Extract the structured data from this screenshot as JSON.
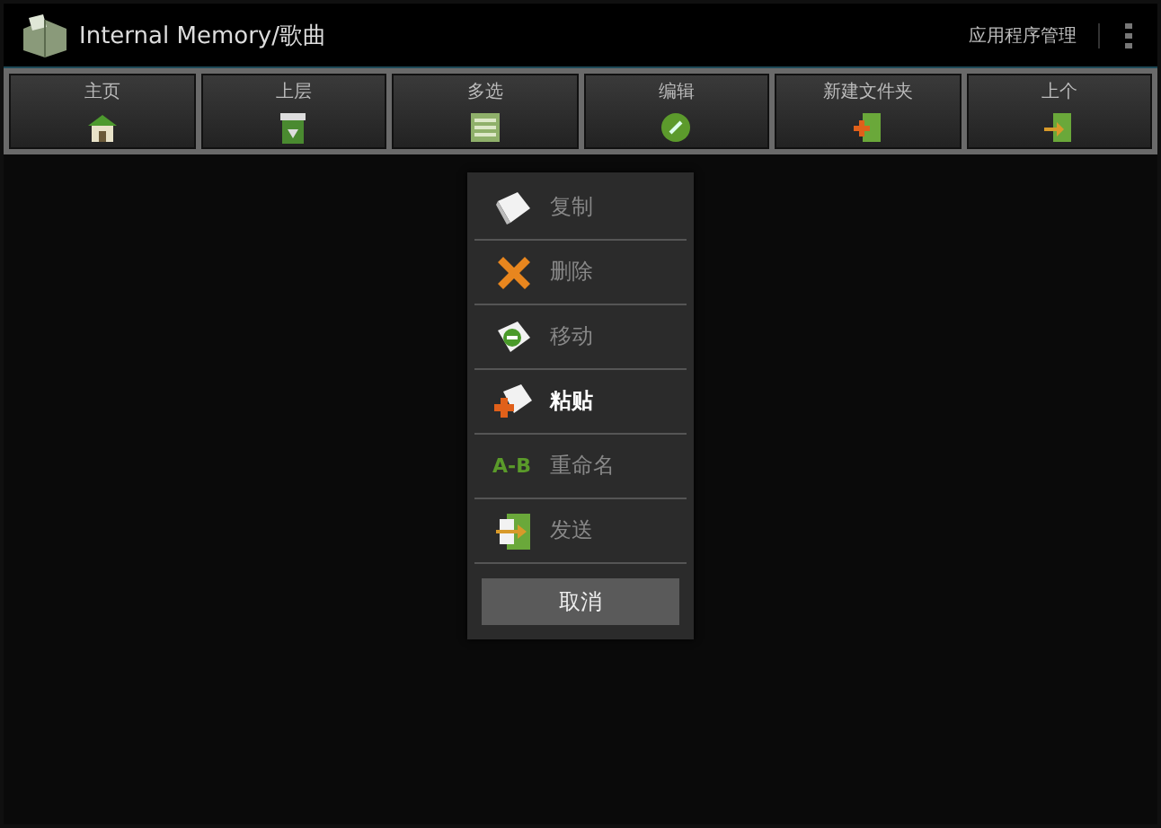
{
  "title_bar": {
    "title": "Internal Memory/歌曲",
    "action": "应用程序管理"
  },
  "toolbar": [
    {
      "label": "主页",
      "kind": "home"
    },
    {
      "label": "上层",
      "kind": "up"
    },
    {
      "label": "多选",
      "kind": "multi"
    },
    {
      "label": "编辑",
      "kind": "edit"
    },
    {
      "label": "新建文件夹",
      "kind": "newfolder"
    },
    {
      "label": "上个",
      "kind": "back"
    }
  ],
  "menu": {
    "items": [
      {
        "label": "复制",
        "kind": "copy",
        "disabled": true
      },
      {
        "label": "删除",
        "kind": "delete",
        "disabled": true
      },
      {
        "label": "移动",
        "kind": "move",
        "disabled": true
      },
      {
        "label": "粘贴",
        "kind": "paste",
        "disabled": false
      },
      {
        "label": "重命名",
        "kind": "rename",
        "icon_text": "A-B",
        "disabled": true
      },
      {
        "label": "发送",
        "kind": "send",
        "disabled": true
      }
    ],
    "cancel": "取消"
  }
}
